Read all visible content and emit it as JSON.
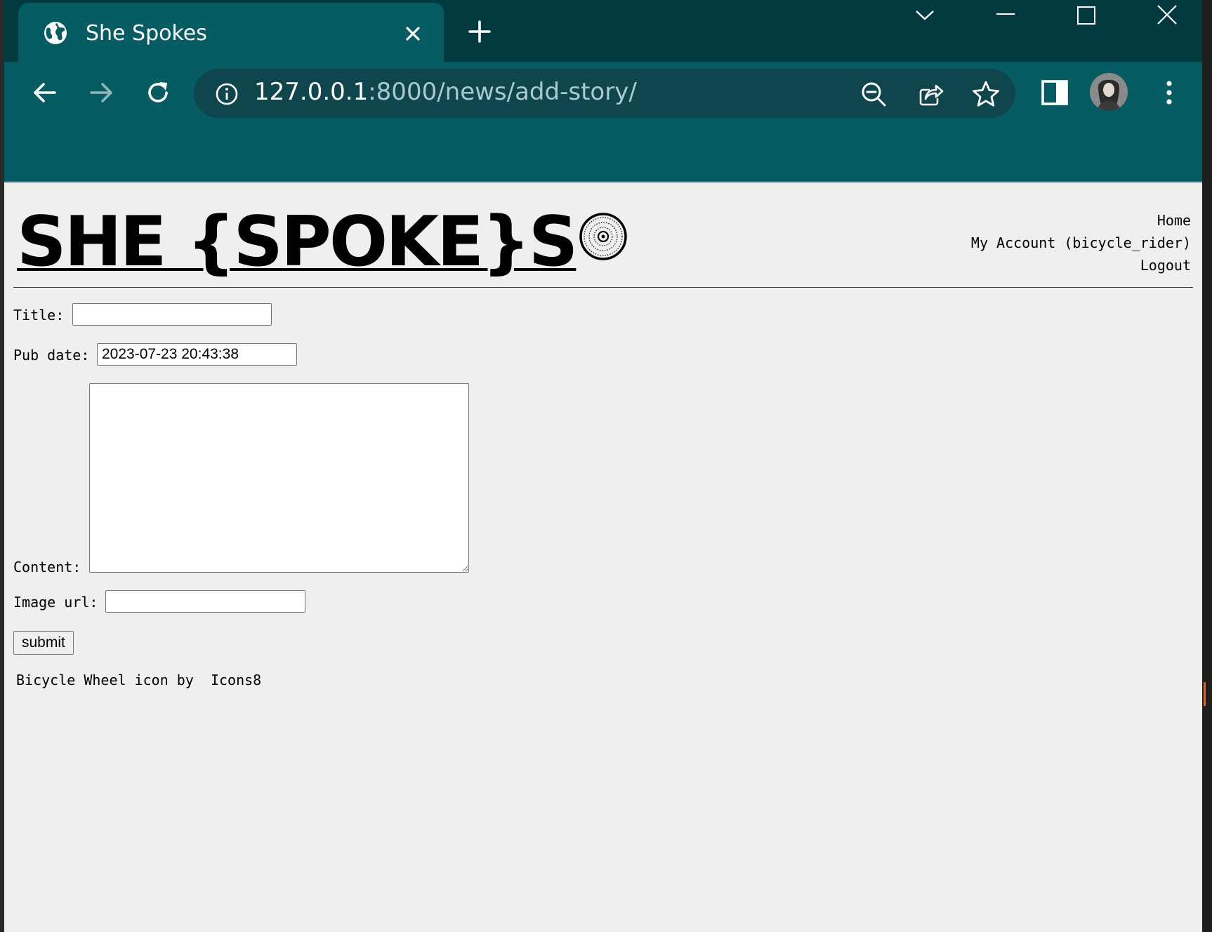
{
  "browser": {
    "tab": {
      "title": "She Spokes",
      "favicon": "globe-icon"
    },
    "window_controls": [
      "chevron-down-icon",
      "minimize-icon",
      "maximize-icon",
      "close-icon"
    ],
    "toolbar": {
      "url_host": "127.0.0.1",
      "url_rest": ":8000/news/add-story/",
      "icons": [
        "back-icon",
        "forward-icon",
        "reload-icon",
        "info-icon",
        "zoom-icon",
        "share-icon",
        "star-icon",
        "sidepanel-icon",
        "avatar",
        "menu-icon"
      ]
    },
    "colors": {
      "frame": "#033a40",
      "toolbar": "#055c63",
      "omnibox": "#0f454c"
    }
  },
  "site": {
    "logo_text": "SHE {SPOKE}S ",
    "nav": {
      "home": "Home",
      "account": "My Account (bicycle_rider)",
      "logout": "Logout"
    }
  },
  "form": {
    "title_label": "Title:",
    "title_value": "",
    "pub_date_label": "Pub date:",
    "pub_date_value": "2023-07-23 20:43:38",
    "content_label": "Content:",
    "content_value": "",
    "image_url_label": "Image url:",
    "image_url_value": "",
    "submit_label": "submit"
  },
  "footer": {
    "credit_prefix": "Bicycle Wheel icon by ",
    "credit_link": "Icons8"
  }
}
